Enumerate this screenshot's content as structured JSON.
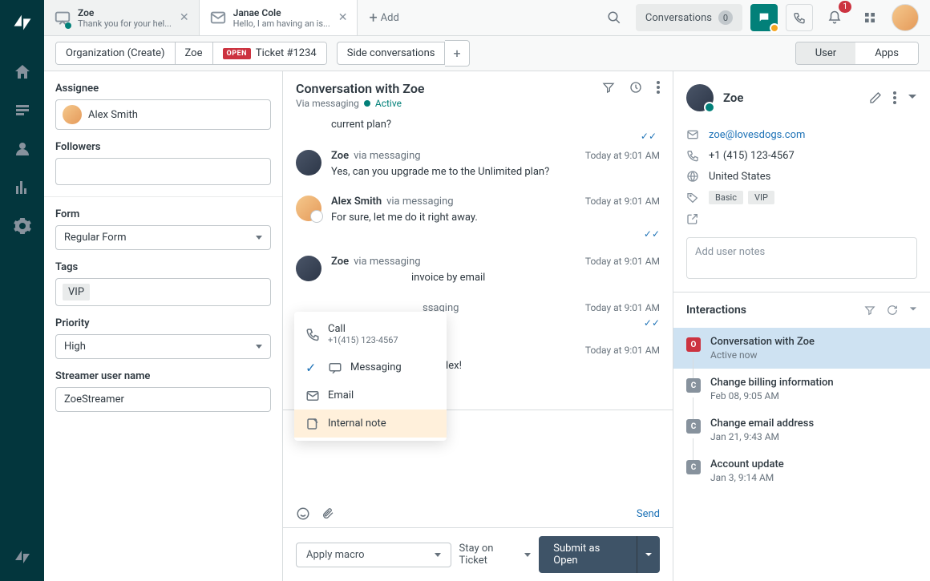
{
  "tabs": {
    "items": [
      {
        "title": "Zoe",
        "subtitle": "Thank you for your hel...",
        "active": true
      },
      {
        "title": "Janae Cole",
        "subtitle": "Hello, I am having an is..."
      }
    ],
    "add_label": "Add"
  },
  "top": {
    "conversations_label": "Conversations",
    "conversations_count": "0",
    "notif_count": "1"
  },
  "breadcrumb": {
    "org": "Organization (Create)",
    "user": "Zoe",
    "open_label": "OPEN",
    "ticket": "Ticket #1234",
    "side": "Side conversations",
    "seg_user": "User",
    "seg_apps": "Apps"
  },
  "left": {
    "assignee_label": "Assignee",
    "assignee_value": "Alex Smith",
    "followers_label": "Followers",
    "form_label": "Form",
    "form_value": "Regular Form",
    "tags_label": "Tags",
    "tag_value": "VIP",
    "priority_label": "Priority",
    "priority_value": "High",
    "streamer_label": "Streamer user name",
    "streamer_value": "ZoeStreamer"
  },
  "convo": {
    "title": "Conversation with Zoe",
    "via": "Via messaging",
    "status": "Active",
    "fragment": "current plan?",
    "messages": [
      {
        "who": "Zoe",
        "via": "via messaging",
        "time": "Today at 9:01 AM",
        "text": "Yes, can you upgrade me to the Unlimited plan?",
        "avatar": "zoe"
      },
      {
        "who": "Alex Smith",
        "via": "via messaging",
        "time": "Today at 9:01 AM",
        "text": "For sure, let me do it right away.",
        "avatar": "alex",
        "read": true
      },
      {
        "who": "Zoe",
        "via": "via messaging",
        "time": "Today at 9:01 AM",
        "text": "invoice by email",
        "avatar": "zoe",
        "partial_left": true
      },
      {
        "who": "",
        "via": "ssaging",
        "time": "Today at 9:01 AM",
        "text": "",
        "hidden_name": true,
        "read": true
      },
      {
        "who": "",
        "via": "",
        "time": "Today at 9:01 AM",
        "text": "elp Alex!",
        "hidden_name": true,
        "partial_left": true
      }
    ],
    "channel_label": "Messaging",
    "send": "Send",
    "macro": "Apply macro",
    "stay": "Stay on Ticket",
    "submit": "Submit as Open"
  },
  "channel_menu": {
    "call": "Call",
    "call_num": "+1(415) 123-4567",
    "messaging": "Messaging",
    "email": "Email",
    "note": "Internal note"
  },
  "user": {
    "name": "Zoe",
    "email": "zoe@lovesdogs.com",
    "phone": "+1 (415) 123-4567",
    "country": "United States",
    "badges": [
      "Basic",
      "VIP"
    ],
    "notes_placeholder": "Add user notes"
  },
  "interactions": {
    "title": "Interactions",
    "items": [
      {
        "badge": "O",
        "open": true,
        "title": "Conversation with Zoe",
        "sub": "Active now",
        "active": true
      },
      {
        "badge": "C",
        "title": "Change billing information",
        "sub": "Feb 08, 9:05 AM"
      },
      {
        "badge": "C",
        "title": "Change email address",
        "sub": "Jan 21, 9:43 AM"
      },
      {
        "badge": "C",
        "title": "Account update",
        "sub": "Jan 3, 9:14 AM"
      }
    ]
  }
}
